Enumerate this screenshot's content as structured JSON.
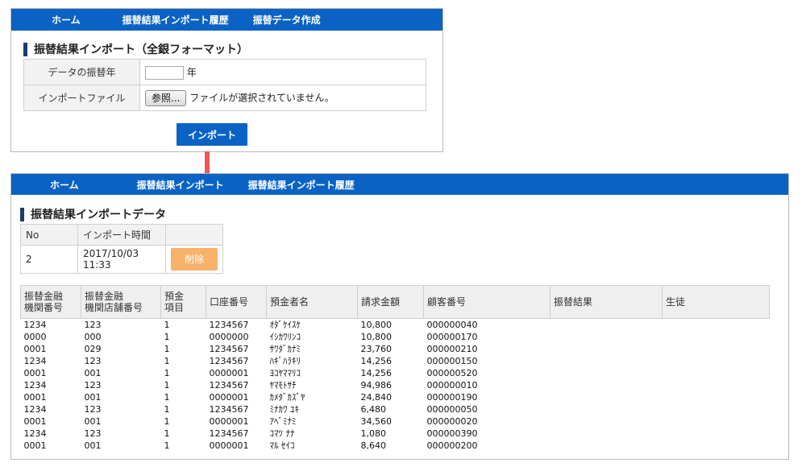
{
  "top_panel": {
    "nav": {
      "home": "ホーム",
      "history": "振替結果インポート履歴",
      "create": "振替データ作成"
    },
    "title": "振替結果インポート（全銀フォーマット）",
    "form": {
      "year_label": "データの振替年",
      "year_value": "",
      "year_unit": "年",
      "file_label": "インポートファイル",
      "browse_label": "参照...",
      "file_status": "ファイルが選択されていません。"
    },
    "import_button": "インポート"
  },
  "arrow_color": "#f2545b",
  "bottom_panel": {
    "nav": {
      "home": "ホーム",
      "import": "振替結果インポート",
      "history": "振替結果インポート履歴"
    },
    "title": "振替結果インポートデータ",
    "import_table": {
      "headers": [
        "No",
        "インポート時間",
        ""
      ],
      "row": {
        "no": "2",
        "time": "2017/10/03 11:33",
        "delete_label": "削除"
      }
    },
    "data_table": {
      "headers": [
        "振替金融\n機関番号",
        "振替金融\n機関店舗番号",
        "預金\n項目",
        "口座番号",
        "預金者名",
        "請求金額",
        "顧客番号",
        "振替結果",
        "生徒"
      ],
      "rows": [
        [
          "1234",
          "123",
          "1",
          "1234567",
          "ｵﾀﾞｹｲｽｹ",
          "10,800",
          "000000040",
          "",
          ""
        ],
        [
          "0000",
          "000",
          "1",
          "0000000",
          "ｲｼｶﾜﾘﾝｺ",
          "10,800",
          "000000170",
          "",
          ""
        ],
        [
          "0001",
          "029",
          "1",
          "1234567",
          "ｻﾜﾀﾞｶﾅﾐ",
          "23,760",
          "000000210",
          "",
          ""
        ],
        [
          "1234",
          "123",
          "1",
          "1234567",
          "ﾊｷﾞﾊﾗｷﾘ",
          "14,256",
          "000000150",
          "",
          ""
        ],
        [
          "0001",
          "001",
          "1",
          "0000001",
          "ﾖｺﾔﾏﾏﾘｺ",
          "14,256",
          "000000520",
          "",
          ""
        ],
        [
          "1234",
          "123",
          "1",
          "1234567",
          "ﾔﾏﾓﾄｻﾁ",
          "94,986",
          "000000010",
          "",
          ""
        ],
        [
          "0001",
          "001",
          "1",
          "0000001",
          "ｶﾒﾀﾞｶｽﾞﾔ",
          "24,840",
          "000000190",
          "",
          ""
        ],
        [
          "1234",
          "123",
          "1",
          "1234567",
          "ﾐﾅｶﾜ ﾕｷ",
          "6,480",
          "000000050",
          "",
          ""
        ],
        [
          "0001",
          "001",
          "1",
          "0000001",
          "ｱﾍﾞﾐﾅﾐ",
          "34,560",
          "000000020",
          "",
          ""
        ],
        [
          "1234",
          "123",
          "1",
          "1234567",
          "ｺﾏﾂ ﾅﾅ",
          "1,080",
          "000000390",
          "",
          ""
        ],
        [
          "0001",
          "001",
          "1",
          "0000001",
          "ﾏﾙ ｾｲｺ",
          "8,640",
          "000000200",
          "",
          ""
        ]
      ]
    }
  }
}
